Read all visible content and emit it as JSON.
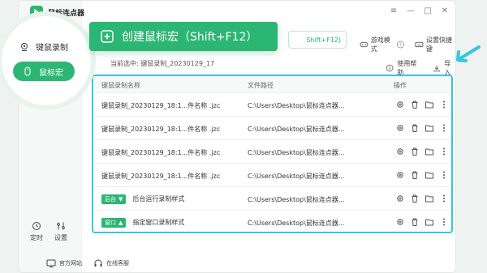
{
  "app": {
    "title": "鼠标连点器"
  },
  "window_controls": {
    "menu": "≡",
    "minimize": "—",
    "maximize": "□",
    "close": "✕"
  },
  "sidebar": {
    "items": [
      {
        "label": "键鼠录制",
        "active": false
      },
      {
        "label": "鼠标宏",
        "active": true
      }
    ],
    "bottom": [
      {
        "label": "定时"
      },
      {
        "label": "设置"
      }
    ],
    "footer": [
      {
        "label": "官方网站"
      },
      {
        "label": "在线客服"
      }
    ]
  },
  "toolbar": {
    "create_label": "创建鼠标宏（Shift+F12）",
    "ghost_label": "Shift+F12)",
    "game_mode": "游戏模式",
    "shortcut": "设置快捷键"
  },
  "selection": {
    "text": "当前选中:  键鼠录制_20230129_17"
  },
  "actions": {
    "help": "使用帮助",
    "import": "导入"
  },
  "table": {
    "columns": [
      "键鼠录制名称",
      "文件路径",
      "操作"
    ],
    "rows": [
      {
        "name": "键鼠录制_20230129_18:1...件名称 .jzc",
        "path": "C:\\Users\\Desktop\\鼠标连点器...",
        "tag": ""
      },
      {
        "name": "键鼠录制_20230129_18:1...件名称 .jzc",
        "path": "C:\\Users\\Desktop\\鼠标连点器...",
        "tag": ""
      },
      {
        "name": "键鼠录制_20230129_18:1...件名称 .jzc",
        "path": "C:\\Users\\Desktop\\鼠标连点器...",
        "tag": ""
      },
      {
        "name": "键鼠录制_20230129_18:1...件名称 .jzc",
        "path": "C:\\Users\\Desktop\\鼠标连点器...",
        "tag": ""
      },
      {
        "name": "后台运行录制样式",
        "path": "C:\\Users\\Desktop\\鼠标连点器...",
        "tag": "后台"
      },
      {
        "name": "指定窗口录制样式",
        "path": "C:\\Users\\Desktop\\鼠标连点器...",
        "tag": "窗口"
      }
    ]
  },
  "colors": {
    "accent": "#2bb673",
    "highlight": "#36c6de"
  }
}
